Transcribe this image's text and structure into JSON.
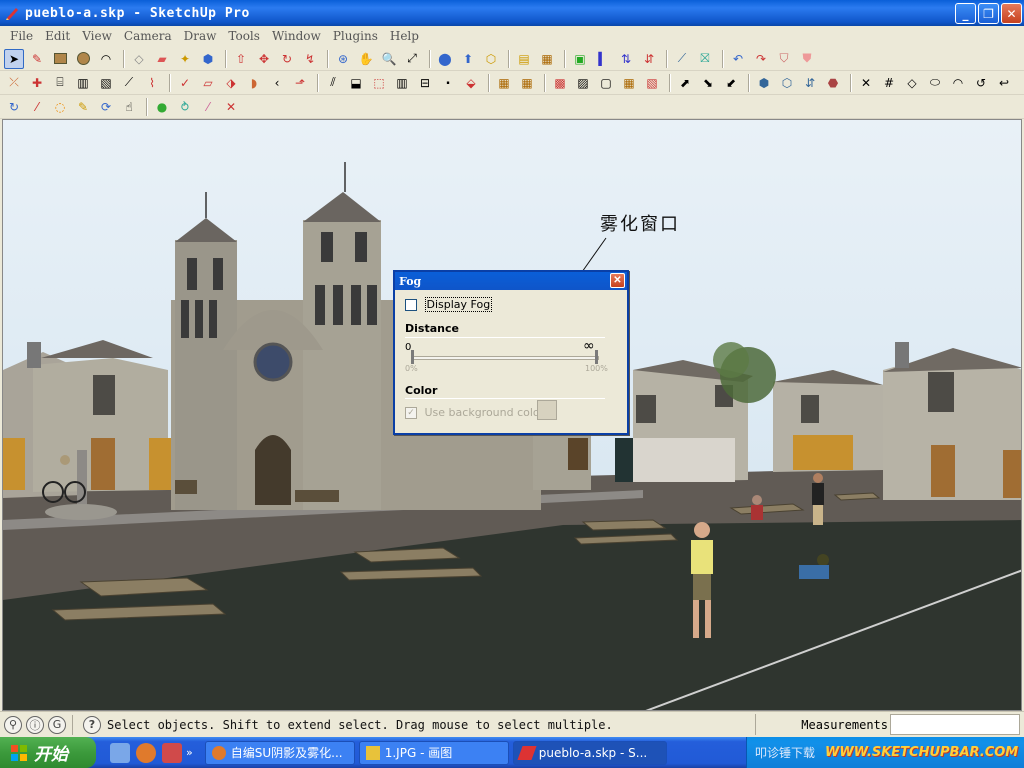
{
  "window": {
    "title": "pueblo-a.skp - SketchUp Pro"
  },
  "menu": [
    "File",
    "Edit",
    "View",
    "Camera",
    "Draw",
    "Tools",
    "Window",
    "Plugins",
    "Help"
  ],
  "annotation": "雾化窗口",
  "fog_dialog": {
    "title": "Fog",
    "display_fog_label": "Display Fog",
    "display_fog_checked": false,
    "distance_label": "Distance",
    "slider_left_value": "0",
    "slider_right_value": "∞",
    "slider_left_pct": "0%",
    "slider_right_pct": "100%",
    "color_label": "Color",
    "use_background_label": "Use background color",
    "use_background_checked": true,
    "swatch_color": "#d7d2bf"
  },
  "status": {
    "message": "Select objects. Shift to extend select. Drag mouse to select multiple.",
    "measurements_label": "Measurements",
    "measurements_value": ""
  },
  "taskbar": {
    "start_label": "开始",
    "tasks": [
      {
        "label": "自编SU阴影及雾化...",
        "icon": "firefox-icon"
      },
      {
        "label": "1.JPG - 画图",
        "icon": "paint-icon"
      },
      {
        "label": "pueblo-a.skp - S...",
        "icon": "sketchup-icon"
      }
    ],
    "tray_text": "叩诊锤下载",
    "watermark": "WWW.SKETCHUPBAR.COM"
  },
  "colors": {
    "sky": "#d6e6f2",
    "ground": "#2f362f",
    "road": "#5f5a55",
    "stone": "#9a968a"
  }
}
